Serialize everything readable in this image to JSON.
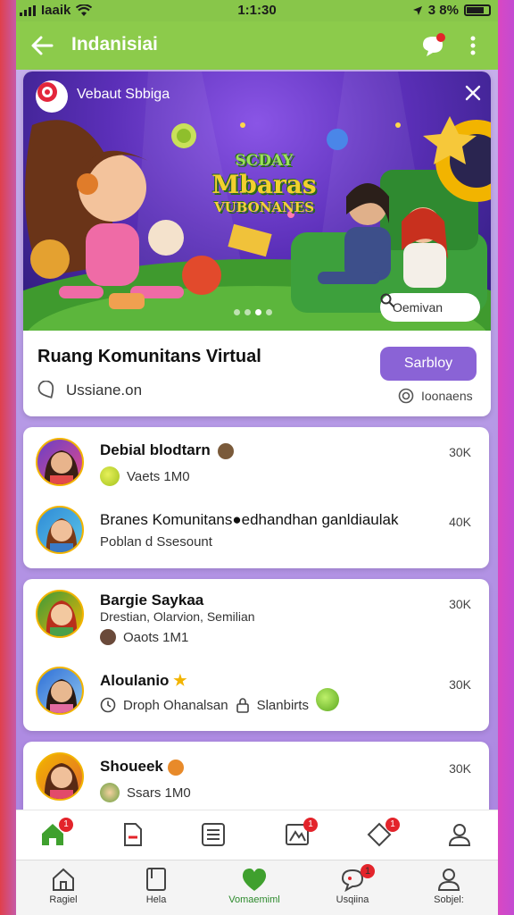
{
  "status_bar": {
    "carrier": "Iaaik",
    "time": "1:1:30",
    "battery": "3 8%"
  },
  "app_bar": {
    "title": "Indanisiai"
  },
  "banner": {
    "brand": "Vebaut Sbbiga",
    "headline_line1": "SCDAY",
    "headline_line2": "Mbaras",
    "headline_line3": "VUBONANES",
    "search_label": "Oemivan",
    "slide_count": 4,
    "active_slide": 2
  },
  "community": {
    "title": "Ruang Komunitans Virtual",
    "join_label": "Sarbloy",
    "location": "Ussiane.on",
    "members": "Ioonaens"
  },
  "lists": [
    {
      "items": [
        {
          "name": "Debial blodtarn",
          "sub": "Vaets 1M0",
          "count": "30K"
        },
        {
          "name": "Branes Komunitans●edhandhan ganldiaulak",
          "sub": "Poblan d Ssesount",
          "count": "40K"
        }
      ]
    },
    {
      "items": [
        {
          "name": "Bargie Saykaa",
          "sub": "Drestian, Olarvion, Semilian",
          "sub2": "Oaots 1M1",
          "count": "30K"
        },
        {
          "name": "Aloulanio",
          "sub": "Droph Ohanalsan",
          "sub_extra": "Slanbirts",
          "count": "30K"
        }
      ]
    },
    {
      "items": [
        {
          "name": "Shoueek",
          "sub": "Ssars 1M0",
          "count": "30K"
        }
      ]
    }
  ],
  "nav_top": {
    "badges": [
      "1",
      "1",
      "1"
    ]
  },
  "nav_bottom": {
    "tabs": [
      {
        "label": "Ragiel"
      },
      {
        "label": "Hela"
      },
      {
        "label": "Vomaemiml"
      },
      {
        "label": "Usqiina",
        "badge": "1"
      },
      {
        "label": "Sobjel:"
      }
    ]
  },
  "colors": {
    "app_bar": "#8ccb4b",
    "accent_button": "#8a63d6",
    "badge": "#e3242b",
    "active_tab": "#2c8a2c"
  }
}
